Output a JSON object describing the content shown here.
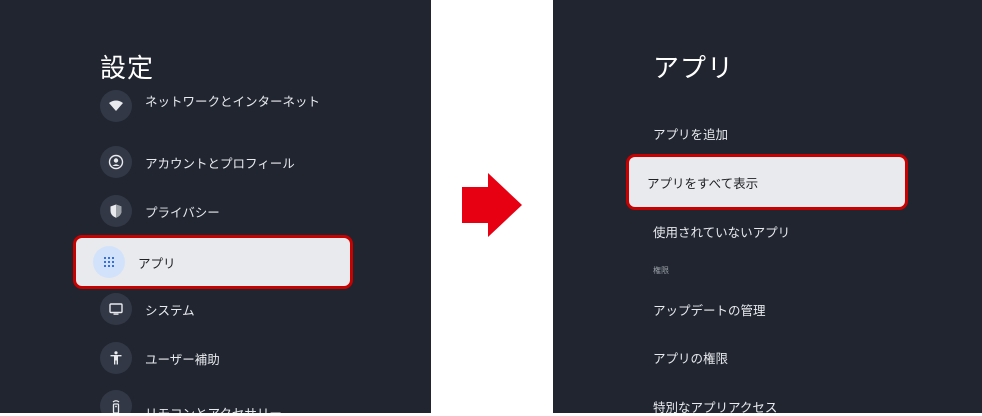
{
  "left": {
    "title": "設定",
    "items": [
      {
        "label": "ネットワークとインターネット",
        "icon": "wifi-icon"
      },
      {
        "label": "アカウントとプロフィール",
        "icon": "account-icon"
      },
      {
        "label": "プライバシー",
        "icon": "shield-icon"
      },
      {
        "label": "アプリ",
        "icon": "apps-grid-icon",
        "selected": true
      },
      {
        "label": "システム",
        "icon": "monitor-icon"
      },
      {
        "label": "ユーザー補助",
        "icon": "accessibility-icon"
      },
      {
        "label": "リモコンとアクセサリー",
        "icon": "remote-icon"
      }
    ]
  },
  "right": {
    "title": "アプリ",
    "items": [
      {
        "label": "アプリを追加"
      },
      {
        "label": "アプリをすべて表示",
        "selected": true
      },
      {
        "label": "使用されていないアプリ"
      }
    ],
    "section_label": "権限",
    "permission_items": [
      {
        "label": "アップデートの管理"
      },
      {
        "label": "アプリの権限"
      },
      {
        "label": "特別なアプリアクセス"
      }
    ]
  },
  "colors": {
    "panel_bg": "#202530",
    "selected_bg": "#e8eaee",
    "highlight_border": "#c70000",
    "arrow": "#e60012"
  }
}
